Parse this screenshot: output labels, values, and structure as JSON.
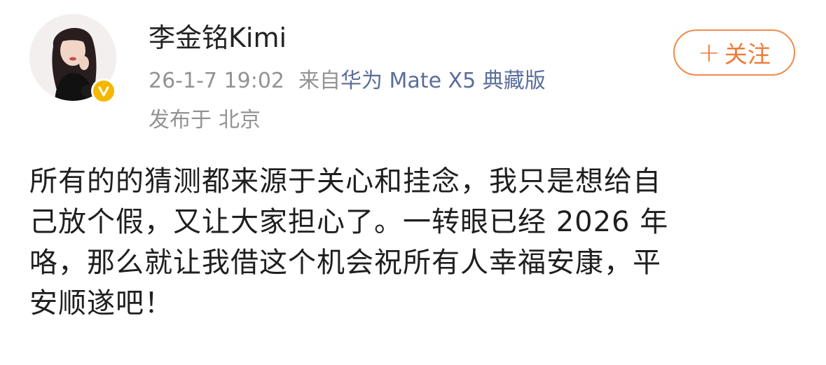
{
  "post": {
    "author": {
      "name": "李金铭Kimi",
      "verified_badge_icon": "verified-v-icon",
      "badge_color": "#f5b800"
    },
    "timestamp": "26-1-7 19:02",
    "source_prefix": "来自",
    "source_device": "华为 Mate X5 典藏版",
    "location_prefix": "发布于",
    "location": "北京",
    "follow_button": {
      "label": "关注",
      "icon": "plus-icon",
      "color": "#f07a36"
    },
    "body_lines": [
      "所有的的猜测都来源于关心和挂念，我只是想给自",
      "己放个假，又让大家担心了。一转眼已经 2026 年",
      "咯，那么就让我借这个机会祝所有人幸福安康，平",
      "安顺遂吧！"
    ]
  }
}
